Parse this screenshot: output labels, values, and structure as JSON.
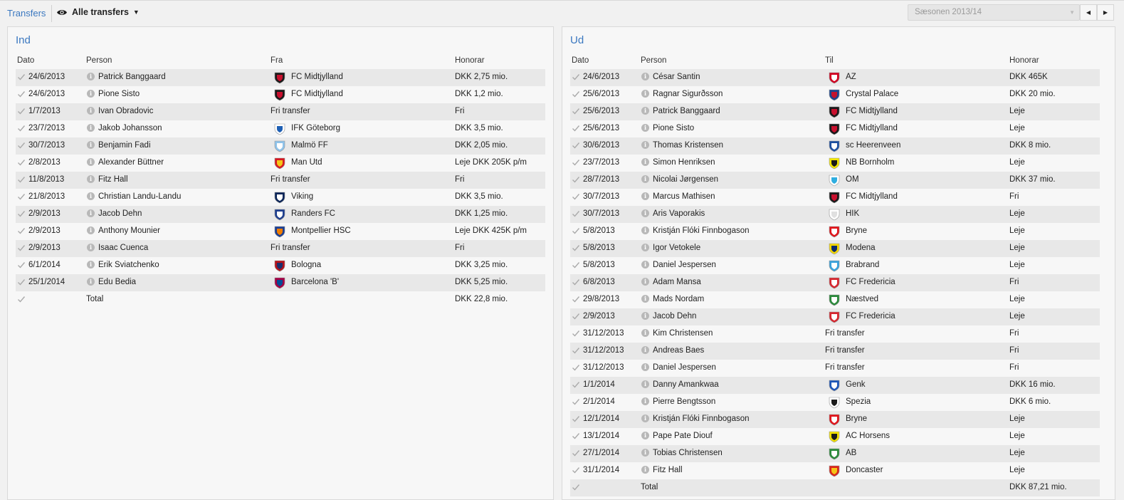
{
  "header": {
    "title": "Transfers",
    "view_label": "Alle transfers",
    "season_value": "Sæsonen 2013/14"
  },
  "ind": {
    "title": "Ind",
    "columns": [
      "Dato",
      "Person",
      "Fra",
      "Honorar"
    ],
    "rows": [
      {
        "date": "24/6/2013",
        "person": "Patrick Banggaard",
        "club": "FC Midtjylland",
        "fee": "DKK 2,75 mio.",
        "crest": "midtjylland-icon",
        "colors": [
          "#1a1a1a",
          "#c8102e"
        ]
      },
      {
        "date": "24/6/2013",
        "person": "Pione Sisto",
        "club": "FC Midtjylland",
        "fee": "DKK 1,2 mio.",
        "crest": "midtjylland-icon",
        "colors": [
          "#1a1a1a",
          "#c8102e"
        ]
      },
      {
        "date": "1/7/2013",
        "person": "Ivan Obradovic",
        "club": "Fri transfer",
        "fee": "Fri",
        "crest": ""
      },
      {
        "date": "23/7/2013",
        "person": "Jakob Johansson",
        "club": "IFK Göteborg",
        "fee": "DKK 3,5 mio.",
        "crest": "ifk-goteborg-icon",
        "colors": [
          "#ffffff",
          "#1e5fb4"
        ]
      },
      {
        "date": "30/7/2013",
        "person": "Benjamin Fadi",
        "club": "Malmö FF",
        "fee": "DKK 2,05 mio.",
        "crest": "malmo-icon",
        "colors": [
          "#8fc3ea",
          "#ffffff"
        ]
      },
      {
        "date": "2/8/2013",
        "person": "Alexander Büttner",
        "club": "Man Utd",
        "fee": "Leje DKK 205K p/m",
        "crest": "man-utd-icon",
        "colors": [
          "#d71920",
          "#f5c518"
        ]
      },
      {
        "date": "11/8/2013",
        "person": "Fitz Hall",
        "club": "Fri transfer",
        "fee": "Fri",
        "crest": ""
      },
      {
        "date": "21/8/2013",
        "person": "Christian Landu-Landu",
        "club": "Viking",
        "fee": "DKK 3,5 mio.",
        "crest": "viking-icon",
        "colors": [
          "#0b2559",
          "#ffffff"
        ]
      },
      {
        "date": "2/9/2013",
        "person": "Jacob Dehn",
        "club": "Randers FC",
        "fee": "DKK 1,25 mio.",
        "crest": "randers-icon",
        "colors": [
          "#1f3f8f",
          "#ffffff"
        ]
      },
      {
        "date": "2/9/2013",
        "person": "Anthony Mounier",
        "club": "Montpellier HSC",
        "fee": "Leje DKK 425K p/m",
        "crest": "montpellier-icon",
        "colors": [
          "#1b3f94",
          "#f07d00"
        ]
      },
      {
        "date": "2/9/2013",
        "person": "Isaac Cuenca",
        "club": "Fri transfer",
        "fee": "Fri",
        "crest": ""
      },
      {
        "date": "6/1/2014",
        "person": "Erik Sviatchenko",
        "club": "Bologna",
        "fee": "DKK 3,25 mio.",
        "crest": "bologna-icon",
        "colors": [
          "#b5121b",
          "#1a2f6e"
        ]
      },
      {
        "date": "25/1/2014",
        "person": "Edu Bedia",
        "club": "Barcelona 'B'",
        "fee": "DKK 5,25 mio.",
        "crest": "barcelona-icon",
        "colors": [
          "#a50044",
          "#004d98"
        ]
      }
    ],
    "total_label": "Total",
    "total_fee": "DKK 22,8 mio."
  },
  "ud": {
    "title": "Ud",
    "columns": [
      "Dato",
      "Person",
      "Til",
      "Honorar"
    ],
    "rows": [
      {
        "date": "24/6/2013",
        "person": "César Santin",
        "club": "AZ",
        "fee": "DKK 465K",
        "crest": "az-icon",
        "colors": [
          "#d2001f",
          "#ffffff"
        ]
      },
      {
        "date": "25/6/2013",
        "person": "Ragnar Sigurðsson",
        "club": "Crystal Palace",
        "fee": "DKK 20 mio.",
        "crest": "crystal-palace-icon",
        "colors": [
          "#1b458f",
          "#c4122e"
        ]
      },
      {
        "date": "25/6/2013",
        "person": "Patrick Banggaard",
        "club": "FC Midtjylland",
        "fee": "Leje",
        "crest": "midtjylland-icon",
        "colors": [
          "#1a1a1a",
          "#c8102e"
        ]
      },
      {
        "date": "25/6/2013",
        "person": "Pione Sisto",
        "club": "FC Midtjylland",
        "fee": "Leje",
        "crest": "midtjylland-icon",
        "colors": [
          "#1a1a1a",
          "#c8102e"
        ]
      },
      {
        "date": "30/6/2013",
        "person": "Thomas Kristensen",
        "club": "sc Heerenveen",
        "fee": "DKK 8 mio.",
        "crest": "heerenveen-icon",
        "colors": [
          "#1c4fa0",
          "#ffffff"
        ]
      },
      {
        "date": "23/7/2013",
        "person": "Simon Henriksen",
        "club": "NB Bornholm",
        "fee": "Leje",
        "crest": "bornholm-icon",
        "colors": [
          "#f2e600",
          "#1a1a1a"
        ]
      },
      {
        "date": "28/7/2013",
        "person": "Nicolai Jørgensen",
        "club": "OM",
        "fee": "DKK 37 mio.",
        "crest": "om-icon",
        "colors": [
          "#ffffff",
          "#2faee0"
        ]
      },
      {
        "date": "30/7/2013",
        "person": "Marcus Mathisen",
        "club": "FC Midtjylland",
        "fee": "Fri",
        "crest": "midtjylland-icon",
        "colors": [
          "#1a1a1a",
          "#c8102e"
        ]
      },
      {
        "date": "30/7/2013",
        "person": "Aris Vaporakis",
        "club": "HIK",
        "fee": "Leje",
        "crest": "hik-icon",
        "colors": [
          "#ffffff",
          "#e0e0e0"
        ]
      },
      {
        "date": "5/8/2013",
        "person": "Kristján Flóki Finnbogason",
        "club": "Bryne",
        "fee": "Leje",
        "crest": "bryne-icon",
        "colors": [
          "#e1141b",
          "#ffffff"
        ]
      },
      {
        "date": "5/8/2013",
        "person": "Igor Vetokele",
        "club": "Modena",
        "fee": "Leje",
        "crest": "modena-icon",
        "colors": [
          "#f5d800",
          "#0d2a6b"
        ]
      },
      {
        "date": "5/8/2013",
        "person": "Daniel Jespersen",
        "club": "Brabrand",
        "fee": "Leje",
        "crest": "brabrand-icon",
        "colors": [
          "#3aa3dc",
          "#ffffff"
        ]
      },
      {
        "date": "6/8/2013",
        "person": "Adam Mansa",
        "club": "FC Fredericia",
        "fee": "Fri",
        "crest": "fredericia-icon",
        "colors": [
          "#d7262e",
          "#ffffff"
        ]
      },
      {
        "date": "29/8/2013",
        "person": "Mads Nordam",
        "club": "Næstved",
        "fee": "Leje",
        "crest": "naestved-icon",
        "colors": [
          "#2a8a3a",
          "#ffffff"
        ]
      },
      {
        "date": "2/9/2013",
        "person": "Jacob Dehn",
        "club": "FC Fredericia",
        "fee": "Leje",
        "crest": "fredericia-icon",
        "colors": [
          "#d7262e",
          "#ffffff"
        ]
      },
      {
        "date": "31/12/2013",
        "person": "Kim Christensen",
        "club": "Fri transfer",
        "fee": "Fri",
        "crest": ""
      },
      {
        "date": "31/12/2013",
        "person": "Andreas Baes",
        "club": "Fri transfer",
        "fee": "Fri",
        "crest": ""
      },
      {
        "date": "31/12/2013",
        "person": "Daniel Jespersen",
        "club": "Fri transfer",
        "fee": "Fri",
        "crest": ""
      },
      {
        "date": "1/1/2014",
        "person": "Danny Amankwaa",
        "club": "Genk",
        "fee": "DKK 16 mio.",
        "crest": "genk-icon",
        "colors": [
          "#1d56b8",
          "#ffffff"
        ]
      },
      {
        "date": "2/1/2014",
        "person": "Pierre Bengtsson",
        "club": "Spezia",
        "fee": "DKK 6 mio.",
        "crest": "spezia-icon",
        "colors": [
          "#ffffff",
          "#1a1a1a"
        ]
      },
      {
        "date": "12/1/2014",
        "person": "Kristján Flóki Finnbogason",
        "club": "Bryne",
        "fee": "Leje",
        "crest": "bryne-icon",
        "colors": [
          "#e1141b",
          "#ffffff"
        ]
      },
      {
        "date": "13/1/2014",
        "person": "Pape Pate Diouf",
        "club": "AC Horsens",
        "fee": "Leje",
        "crest": "horsens-icon",
        "colors": [
          "#f2e000",
          "#1a1a1a"
        ]
      },
      {
        "date": "27/1/2014",
        "person": "Tobias Christensen",
        "club": "AB",
        "fee": "Leje",
        "crest": "ab-icon",
        "colors": [
          "#2a8a3a",
          "#ffffff"
        ]
      },
      {
        "date": "31/1/2014",
        "person": "Fitz Hall",
        "club": "Doncaster",
        "fee": "Leje",
        "crest": "doncaster-icon",
        "colors": [
          "#d9261c",
          "#f5c518"
        ]
      }
    ],
    "total_label": "Total",
    "total_fee": "DKK 87,21 mio."
  }
}
